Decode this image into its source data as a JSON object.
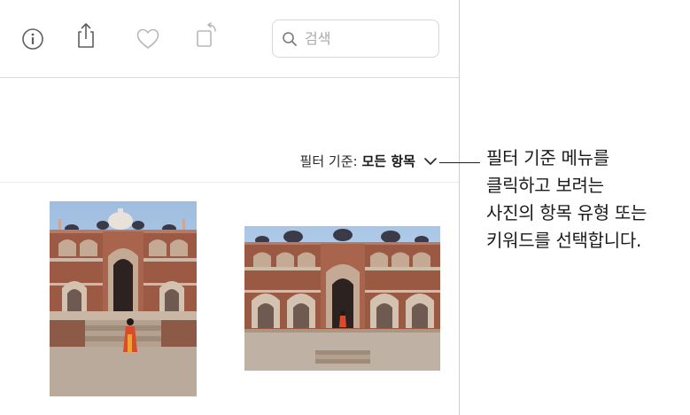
{
  "toolbar": {
    "icons": [
      "info-icon",
      "share-icon",
      "heart-icon",
      "rotate-icon"
    ],
    "search_icon": "magnifying-glass",
    "search_placeholder": "검색"
  },
  "filter": {
    "prefix": "필터 기준:",
    "value": "모든 항목"
  },
  "photos": [
    {
      "name": "humayun-tomb-portrait",
      "orientation": "portrait"
    },
    {
      "name": "humayun-tomb-landscape",
      "orientation": "landscape"
    }
  ],
  "callout": {
    "lines": [
      "필터 기준 메뉴를",
      "클릭하고 보려는",
      "사진의 항목 유형 또는",
      "키워드를 선택합니다."
    ]
  },
  "colors": {
    "icon": "#6b6b6b",
    "border": "#cfcfcf",
    "text": "#1b1b1b"
  }
}
